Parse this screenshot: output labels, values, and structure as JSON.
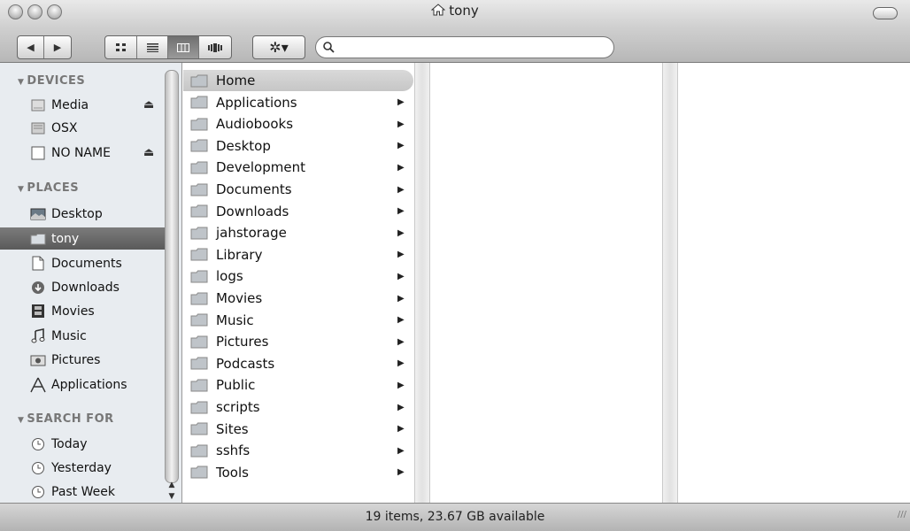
{
  "window": {
    "title": "tony"
  },
  "toolbar": {
    "back": "◀",
    "forward": "▶",
    "action_label": "✲▾"
  },
  "search": {
    "value": "",
    "placeholder": ""
  },
  "sidebar": {
    "devices_header": "DEVICES",
    "places_header": "PLACES",
    "search_header": "SEARCH FOR",
    "devices": [
      {
        "label": "Media",
        "icon": "drive-icon",
        "eject": true
      },
      {
        "label": "OSX",
        "icon": "drive-icon",
        "eject": false
      },
      {
        "label": "NO NAME",
        "icon": "drive-icon",
        "eject": true
      }
    ],
    "places": [
      {
        "label": "Desktop",
        "icon": "desktop-icon"
      },
      {
        "label": "tony",
        "icon": "home-folder-icon",
        "selected": true
      },
      {
        "label": "Documents",
        "icon": "documents-icon"
      },
      {
        "label": "Downloads",
        "icon": "downloads-icon"
      },
      {
        "label": "Movies",
        "icon": "movies-icon"
      },
      {
        "label": "Music",
        "icon": "music-icon"
      },
      {
        "label": "Pictures",
        "icon": "pictures-icon"
      },
      {
        "label": "Applications",
        "icon": "applications-icon"
      }
    ],
    "searches": [
      {
        "label": "Today",
        "icon": "clock-icon"
      },
      {
        "label": "Yesterday",
        "icon": "clock-icon"
      },
      {
        "label": "Past Week",
        "icon": "clock-icon"
      }
    ]
  },
  "column1": {
    "items": [
      {
        "label": "Home",
        "selected": true,
        "arrow": false
      },
      {
        "label": "Applications",
        "arrow": true
      },
      {
        "label": "Audiobooks",
        "arrow": true
      },
      {
        "label": "Desktop",
        "arrow": true
      },
      {
        "label": "Development",
        "arrow": true
      },
      {
        "label": "Documents",
        "arrow": true
      },
      {
        "label": "Downloads",
        "arrow": true
      },
      {
        "label": "jahstorage",
        "arrow": true
      },
      {
        "label": "Library",
        "arrow": true
      },
      {
        "label": "logs",
        "arrow": true
      },
      {
        "label": "Movies",
        "arrow": true
      },
      {
        "label": "Music",
        "arrow": true
      },
      {
        "label": "Pictures",
        "arrow": true
      },
      {
        "label": "Podcasts",
        "arrow": true
      },
      {
        "label": "Public",
        "arrow": true
      },
      {
        "label": "scripts",
        "arrow": true
      },
      {
        "label": "Sites",
        "arrow": true
      },
      {
        "label": "sshfs",
        "arrow": true
      },
      {
        "label": "Tools",
        "arrow": true
      }
    ]
  },
  "status": {
    "text": "19 items, 23.67 GB available"
  },
  "colors": {
    "sidebar_bg": "#e8ecf0",
    "selection": "#6a6a6a",
    "folder": "#bfc4c9"
  }
}
